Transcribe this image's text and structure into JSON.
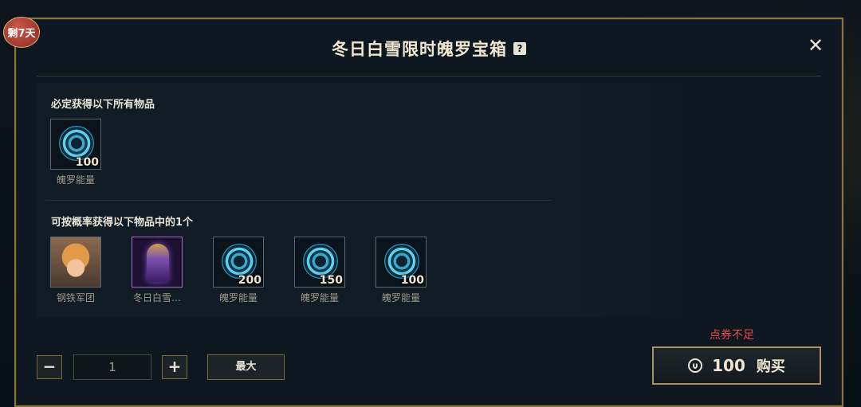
{
  "badge": "剩7天",
  "dialog": {
    "title": "冬日白雪限时魄罗宝箱",
    "help_icon": "?",
    "close_icon": "✕"
  },
  "guaranteed": {
    "title": "必定获得以下所有物品",
    "items": [
      {
        "name": "魄罗能量",
        "qty": "100",
        "icon": "poro-energy-icon"
      }
    ]
  },
  "random": {
    "title": "可按概率获得以下物品中的1个",
    "items": [
      {
        "name": "钢铁军团",
        "qty": "",
        "icon": "champion-portrait-icon"
      },
      {
        "name": "冬日白雪…",
        "qty": "",
        "icon": "totem-icon"
      },
      {
        "name": "魄罗能量",
        "qty": "200",
        "icon": "poro-energy-icon"
      },
      {
        "name": "魄罗能量",
        "qty": "150",
        "icon": "poro-energy-icon"
      },
      {
        "name": "魄罗能量",
        "qty": "100",
        "icon": "poro-energy-icon"
      }
    ]
  },
  "controls": {
    "minus": "−",
    "quantity": "1",
    "plus": "+",
    "max": "最大"
  },
  "purchase": {
    "warning": "点券不足",
    "price": "100",
    "label": "购买"
  }
}
